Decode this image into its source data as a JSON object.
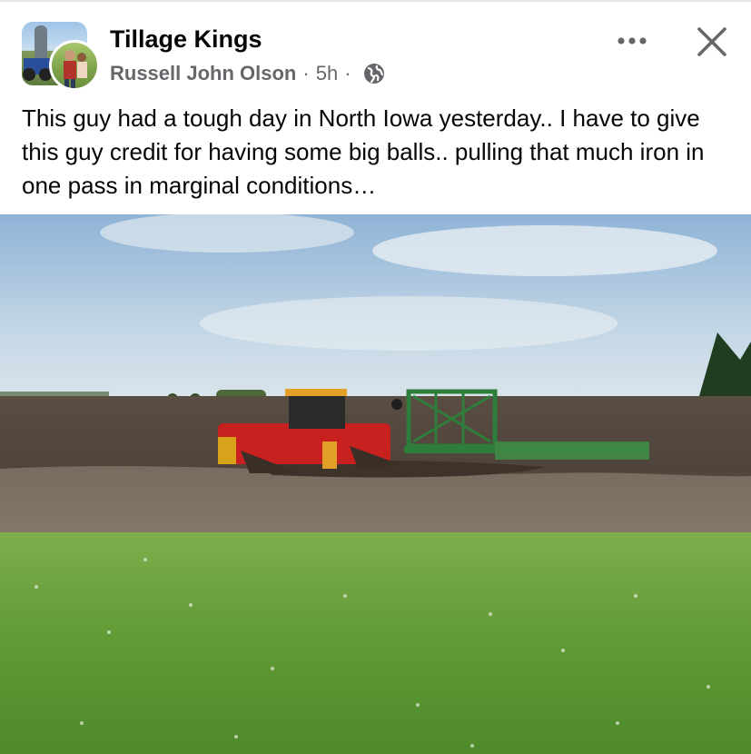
{
  "post": {
    "group_name": "Tillage Kings",
    "author": "Russell John Olson",
    "separator": "·",
    "time": "5h",
    "privacy_icon": "globe-icon",
    "text": "This guy had a tough day in North Iowa yesterday.. I have to give this guy credit for having some big balls.. pulling that much iron in one pass in marginal conditions…"
  },
  "actions": {
    "more_icon": "more-options-icon",
    "close_icon": "close-icon"
  },
  "colors": {
    "text_primary": "#050505",
    "text_secondary": "#65676b",
    "tractor_red": "#c81f1f",
    "implement_green": "#2f7d3a"
  }
}
